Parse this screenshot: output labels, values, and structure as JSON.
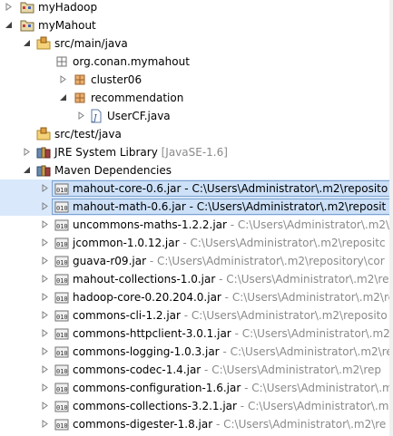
{
  "tree": {
    "rows": [
      {
        "label": "myHadoop",
        "decoration": "",
        "icon": "project-icon"
      },
      {
        "label": "myMahout",
        "decoration": "",
        "icon": "project-icon"
      },
      {
        "label": "src/main/java",
        "decoration": "",
        "icon": "source-folder-icon"
      },
      {
        "label": "org.conan.mymahout",
        "decoration": "",
        "icon": "package-icon"
      },
      {
        "label": "cluster06",
        "decoration": "",
        "icon": "package-icon"
      },
      {
        "label": "recommendation",
        "decoration": "",
        "icon": "package-icon"
      },
      {
        "label": "UserCF.java",
        "decoration": "",
        "icon": "java-file-icon"
      },
      {
        "label": "src/test/java",
        "decoration": "",
        "icon": "source-folder-icon"
      },
      {
        "label": "JRE System Library",
        "decoration": " [JavaSE-1.6]",
        "icon": "library-icon"
      },
      {
        "label": "Maven Dependencies",
        "decoration": "",
        "icon": "library-icon"
      },
      {
        "label": "mahout-core-0.6.jar",
        "decoration": " - C:\\Users\\Administrator\\.m2\\reposito",
        "icon": "jar-icon"
      },
      {
        "label": "mahout-math-0.6.jar",
        "decoration": " - C:\\Users\\Administrator\\.m2\\reposit",
        "icon": "jar-icon"
      },
      {
        "label": "uncommons-maths-1.2.2.jar",
        "decoration": " - C:\\Users\\Administrator\\.m2\\",
        "icon": "jar-icon"
      },
      {
        "label": "jcommon-1.0.12.jar",
        "decoration": " - C:\\Users\\Administrator\\.m2\\repositc",
        "icon": "jar-icon"
      },
      {
        "label": "guava-r09.jar",
        "decoration": " - C:\\Users\\Administrator\\.m2\\repository\\cor",
        "icon": "jar-icon"
      },
      {
        "label": "mahout-collections-1.0.jar",
        "decoration": " - C:\\Users\\Administrator\\.m2\\re",
        "icon": "jar-icon"
      },
      {
        "label": "hadoop-core-0.20.204.0.jar",
        "decoration": " - C:\\Users\\Administrator\\.m2\\re",
        "icon": "jar-icon"
      },
      {
        "label": "commons-cli-1.2.jar",
        "decoration": " - C:\\Users\\Administrator\\.m2\\reposito",
        "icon": "jar-icon"
      },
      {
        "label": "commons-httpclient-3.0.1.jar",
        "decoration": " - C:\\Users\\Administrator\\.m2",
        "icon": "jar-icon"
      },
      {
        "label": "commons-logging-1.0.3.jar",
        "decoration": " - C:\\Users\\Administrator\\.m2\\re",
        "icon": "jar-icon"
      },
      {
        "label": "commons-codec-1.4.jar",
        "decoration": " - C:\\Users\\Administrator\\.m2\\rep",
        "icon": "jar-icon"
      },
      {
        "label": "commons-configuration-1.6.jar",
        "decoration": " - C:\\Users\\Administrator\\.m",
        "icon": "jar-icon"
      },
      {
        "label": "commons-collections-3.2.1.jar",
        "decoration": " - C:\\Users\\Administrator\\.m",
        "icon": "jar-icon"
      },
      {
        "label": "commons-digester-1.8.jar",
        "decoration": " - C:\\Users\\Administrator\\.m2\\re",
        "icon": "jar-icon"
      }
    ]
  },
  "colors": {
    "selection_bg": "#cce0f8",
    "selection_border": "#7da2ce",
    "decoration_text": "#8a8a8a"
  }
}
